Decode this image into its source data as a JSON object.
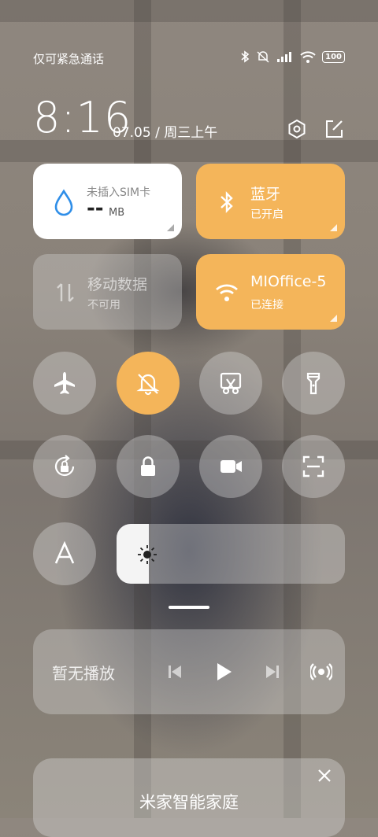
{
  "status_bar": {
    "carrier": "仅可紧急通话",
    "battery": "100",
    "icons": [
      "bluetooth-icon",
      "silent-icon",
      "signal-icon",
      "wifi-icon",
      "battery-icon"
    ]
  },
  "header": {
    "time": "8:16",
    "date": "07.05 / 周三上午",
    "buttons": [
      "settings-icon",
      "edit-icon"
    ]
  },
  "tiles": {
    "data": {
      "title": "未插入SIM卡",
      "value": "--",
      "unit": "MB"
    },
    "bluetooth": {
      "title": "蓝牙",
      "status": "已开启"
    },
    "mobile_data": {
      "title": "移动数据",
      "status": "不可用"
    },
    "wifi": {
      "title": "MIOffice-5",
      "status": "已连接"
    }
  },
  "toggles": [
    {
      "name": "airplane",
      "icon": "airplane-icon",
      "on": false
    },
    {
      "name": "silent",
      "icon": "bell-off-icon",
      "on": true
    },
    {
      "name": "screenshot",
      "icon": "scissors-icon",
      "on": false
    },
    {
      "name": "flashlight",
      "icon": "flashlight-icon",
      "on": false
    },
    {
      "name": "rotation-lock",
      "icon": "rotation-lock-icon",
      "on": false
    },
    {
      "name": "lock-screen",
      "icon": "lock-icon",
      "on": false
    },
    {
      "name": "screen-record",
      "icon": "video-camera-icon",
      "on": false
    },
    {
      "name": "scanner",
      "icon": "scan-icon",
      "on": false
    },
    {
      "name": "font",
      "icon": "font-icon",
      "on": false
    }
  ],
  "brightness": {
    "level": 0.14
  },
  "media": {
    "status": "暂无播放"
  },
  "smart_home": {
    "title": "米家智能家庭"
  },
  "colors": {
    "accent": "#f4b55a",
    "data_tile": "#ffffff",
    "water_icon": "#2f8ee8"
  }
}
